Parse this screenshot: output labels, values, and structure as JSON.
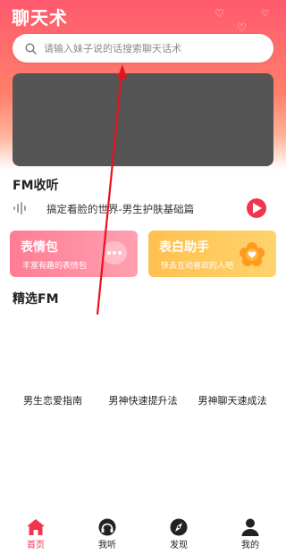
{
  "app": {
    "title": "聊天术"
  },
  "search": {
    "placeholder": "请输入妹子说的话搜索聊天话术"
  },
  "fm_section": {
    "title": "FM收听",
    "now_playing": "搞定看脸的世界-男生护肤基础篇"
  },
  "cards": [
    {
      "title": "表情包",
      "subtitle": "丰富有趣的表情包",
      "icon": "chat-bubble-icon",
      "color": "#ff8aa0"
    },
    {
      "title": "表白助手",
      "subtitle": "快去互动喜欢的人吧",
      "icon": "heart-flower-icon",
      "color": "#ffc454"
    }
  ],
  "featured_fm": {
    "title": "精选FM",
    "items": [
      "男生恋爱指南",
      "男神快速提升法",
      "男神聊天速成法"
    ]
  },
  "bottom_nav": {
    "items": [
      {
        "label": "首页",
        "icon": "home-icon",
        "active": true
      },
      {
        "label": "我听",
        "icon": "headphones-icon",
        "active": false
      },
      {
        "label": "发现",
        "icon": "compass-icon",
        "active": false
      },
      {
        "label": "我的",
        "icon": "person-icon",
        "active": false
      }
    ]
  },
  "colors": {
    "accent": "#f0364f",
    "banner_placeholder": "#555555"
  }
}
